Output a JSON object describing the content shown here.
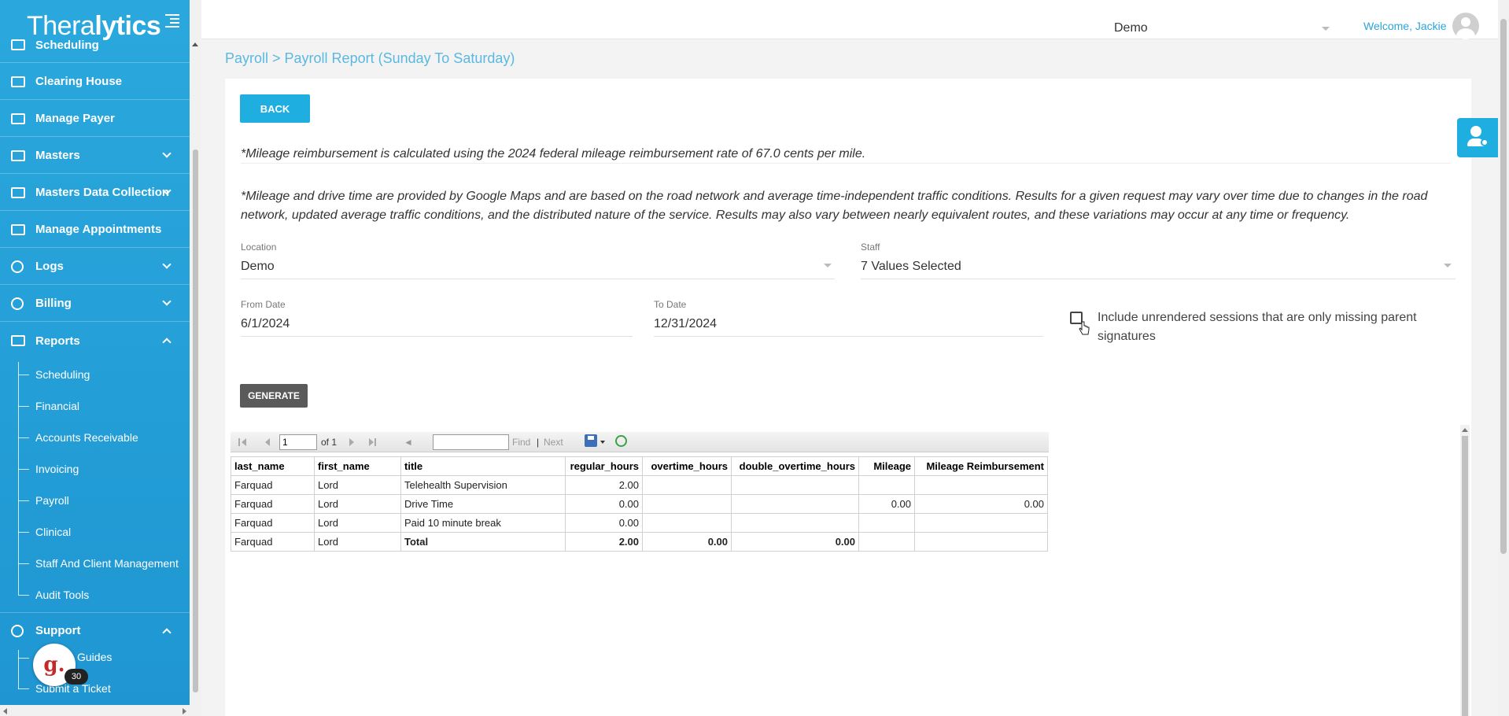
{
  "brand": {
    "logo_pre": "Thera",
    "logo_bold": "lytics"
  },
  "sidebar": {
    "items": [
      {
        "label": "Scheduling"
      },
      {
        "label": "Clearing House"
      },
      {
        "label": "Manage Payer"
      },
      {
        "label": "Masters"
      },
      {
        "label": "Masters Data Collection"
      },
      {
        "label": "Manage Appointments"
      },
      {
        "label": "Logs"
      },
      {
        "label": "Billing"
      },
      {
        "label": "Reports"
      }
    ],
    "reports_sub": [
      "Scheduling",
      "Financial",
      "Accounts Receivable",
      "Invoicing",
      "Payroll",
      "Clinical",
      "Staff And Client Management",
      "Audit Tools"
    ],
    "support": {
      "label": "Support",
      "sub": [
        "Guides",
        "Submit a Ticket"
      ]
    },
    "guide_badge": "30",
    "guide_letter": "g."
  },
  "topbar": {
    "location": "Demo",
    "welcome": "Welcome, Jackie"
  },
  "breadcrumb": "Payroll > Payroll Report (Sunday To Saturday)",
  "buttons": {
    "back": "BACK",
    "generate": "GENERATE"
  },
  "notes": {
    "mileage_rate": "*Mileage reimbursement is calculated using the 2024 federal mileage reimbursement rate of 67.0 cents per mile.",
    "maps_disclaimer": "*Mileage and drive time are provided by Google Maps and are based on the road network and average time-independent traffic conditions. Results for a given request may vary over time due to changes in the road network, updated average traffic conditions, and the distributed nature of the service. Results may also vary between nearly equivalent routes, and these variations may occur at any time or frequency."
  },
  "filters": {
    "location_label": "Location",
    "location_value": "Demo",
    "staff_label": "Staff",
    "staff_value": "7 Values Selected",
    "from_label": "From Date",
    "from_value": "6/1/2024",
    "to_label": "To Date",
    "to_value": "12/31/2024",
    "include_unrendered": "Include unrendered sessions that are only missing parent signatures"
  },
  "viewer": {
    "page": "1",
    "of": "of 1",
    "find": "Find",
    "sep": "|",
    "next": "Next",
    "columns": [
      "last_name",
      "first_name",
      "title",
      "regular_hours",
      "overtime_hours",
      "double_overtime_hours",
      "Mileage",
      "Mileage Reimbursement"
    ],
    "rows": [
      [
        "Farquad",
        "Lord",
        "Telehealth Supervision",
        "2.00",
        "",
        "",
        "",
        ""
      ],
      [
        "Farquad",
        "Lord",
        "Drive Time",
        "0.00",
        "",
        "",
        "0.00",
        "0.00"
      ],
      [
        "Farquad",
        "Lord",
        "Paid 10 minute break",
        "0.00",
        "",
        "",
        "",
        ""
      ],
      [
        "Farquad",
        "Lord",
        "Total",
        "2.00",
        "0.00",
        "0.00",
        "",
        ""
      ]
    ]
  }
}
